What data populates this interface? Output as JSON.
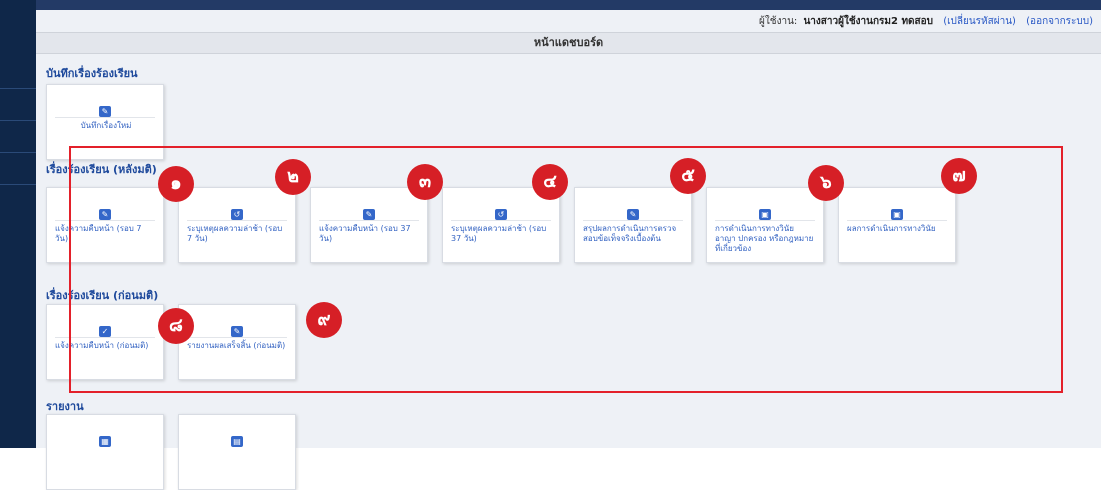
{
  "header": {
    "user_label": "ผู้ใช้งาน:",
    "user_name": "นางสาวผู้ใช้งานกรม2 ทดสอบ",
    "change_password": "(เปลี่ยนรหัสผ่าน)",
    "logout": "(ออกจากระบบ)"
  },
  "page_title": "หน้าแดชบอร์ด",
  "sections": {
    "record": {
      "title": "บันทึกเรื่องร้องเรียน",
      "cards": [
        {
          "label": "บันทึกเรื่องใหม่",
          "icon": "edit-icon"
        }
      ]
    },
    "after": {
      "title": "เรื่องร้องเรียน (หลังมติ)",
      "cards": [
        {
          "label": "แจ้งความคืบหน้า (รอบ 7 วัน)",
          "icon": "edit-icon"
        },
        {
          "label": "ระบุเหตุผลความล่าช้า (รอบ 7 วัน)",
          "icon": "history-icon"
        },
        {
          "label": "แจ้งความคืบหน้า (รอบ 37 วัน)",
          "icon": "edit-icon"
        },
        {
          "label": "ระบุเหตุผลความล่าช้า (รอบ 37 วัน)",
          "icon": "history-icon"
        },
        {
          "label": "สรุปผลการดำเนินการตรวจสอบข้อเท็จจริงเบื้องต้น",
          "icon": "edit-icon"
        },
        {
          "label": "การดำเนินการทางวินัย อาญา ปกครอง หรือกฎหมายที่เกี่ยวข้อง",
          "icon": "save-icon"
        },
        {
          "label": "ผลการดำเนินการทางวินัย",
          "icon": "save-icon"
        }
      ]
    },
    "before": {
      "title": "เรื่องร้องเรียน (ก่อนมติ)",
      "cards": [
        {
          "label": "แจ้งความคืบหน้า (ก่อนมติ)",
          "icon": "check-icon"
        },
        {
          "label": "รายงานผลเสร็จสิ้น (ก่อนมติ)",
          "icon": "edit-icon"
        }
      ]
    },
    "report": {
      "title": "รายงาน",
      "cards": [
        {
          "icon": "calculator-icon"
        },
        {
          "icon": "calendar-icon"
        }
      ]
    }
  },
  "annotations": [
    "๑",
    "๒",
    "๓",
    "๔",
    "๕",
    "๖",
    "๗",
    "๘",
    "๙"
  ],
  "colors": {
    "annotation": "#d61f26",
    "frame": "#e3202a",
    "link": "#3463c2"
  }
}
